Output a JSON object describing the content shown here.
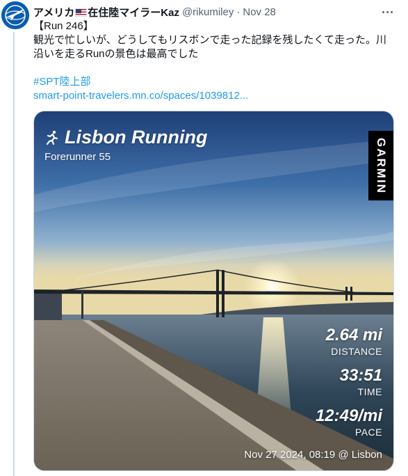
{
  "tweet": {
    "display_name_part1": "アメリカ",
    "display_name_part2": "在住陸マイラーKaz",
    "handle": "@rikumiley",
    "separator": "·",
    "date": "Nov 28",
    "more_icon": "more-horizontal-icon",
    "lines": [
      "【Run 246】",
      "観光で忙しいが、どうしてもリスボンで走った記録を残したくて走った。川",
      "沿いを走るRunの景色は最高でした"
    ],
    "hashtag": "#SPT陸上部",
    "link": "smart-point-travelers.mn.co/spaces/1039812..."
  },
  "media": {
    "title": "Lisbon Running",
    "device": "Forerunner 55",
    "brand": "GARMIN",
    "stats": [
      {
        "value": "2.64 mi",
        "label": "DISTANCE"
      },
      {
        "value": "33:51",
        "label": "TIME"
      },
      {
        "value": "12:49/mi",
        "label": "PACE"
      }
    ],
    "footer": "Nov 27 2024, 08:19 @ Lisbon"
  },
  "colors": {
    "link": "#1d9bf0",
    "muted": "#536471",
    "avatar_bg": "#0a5db0"
  }
}
